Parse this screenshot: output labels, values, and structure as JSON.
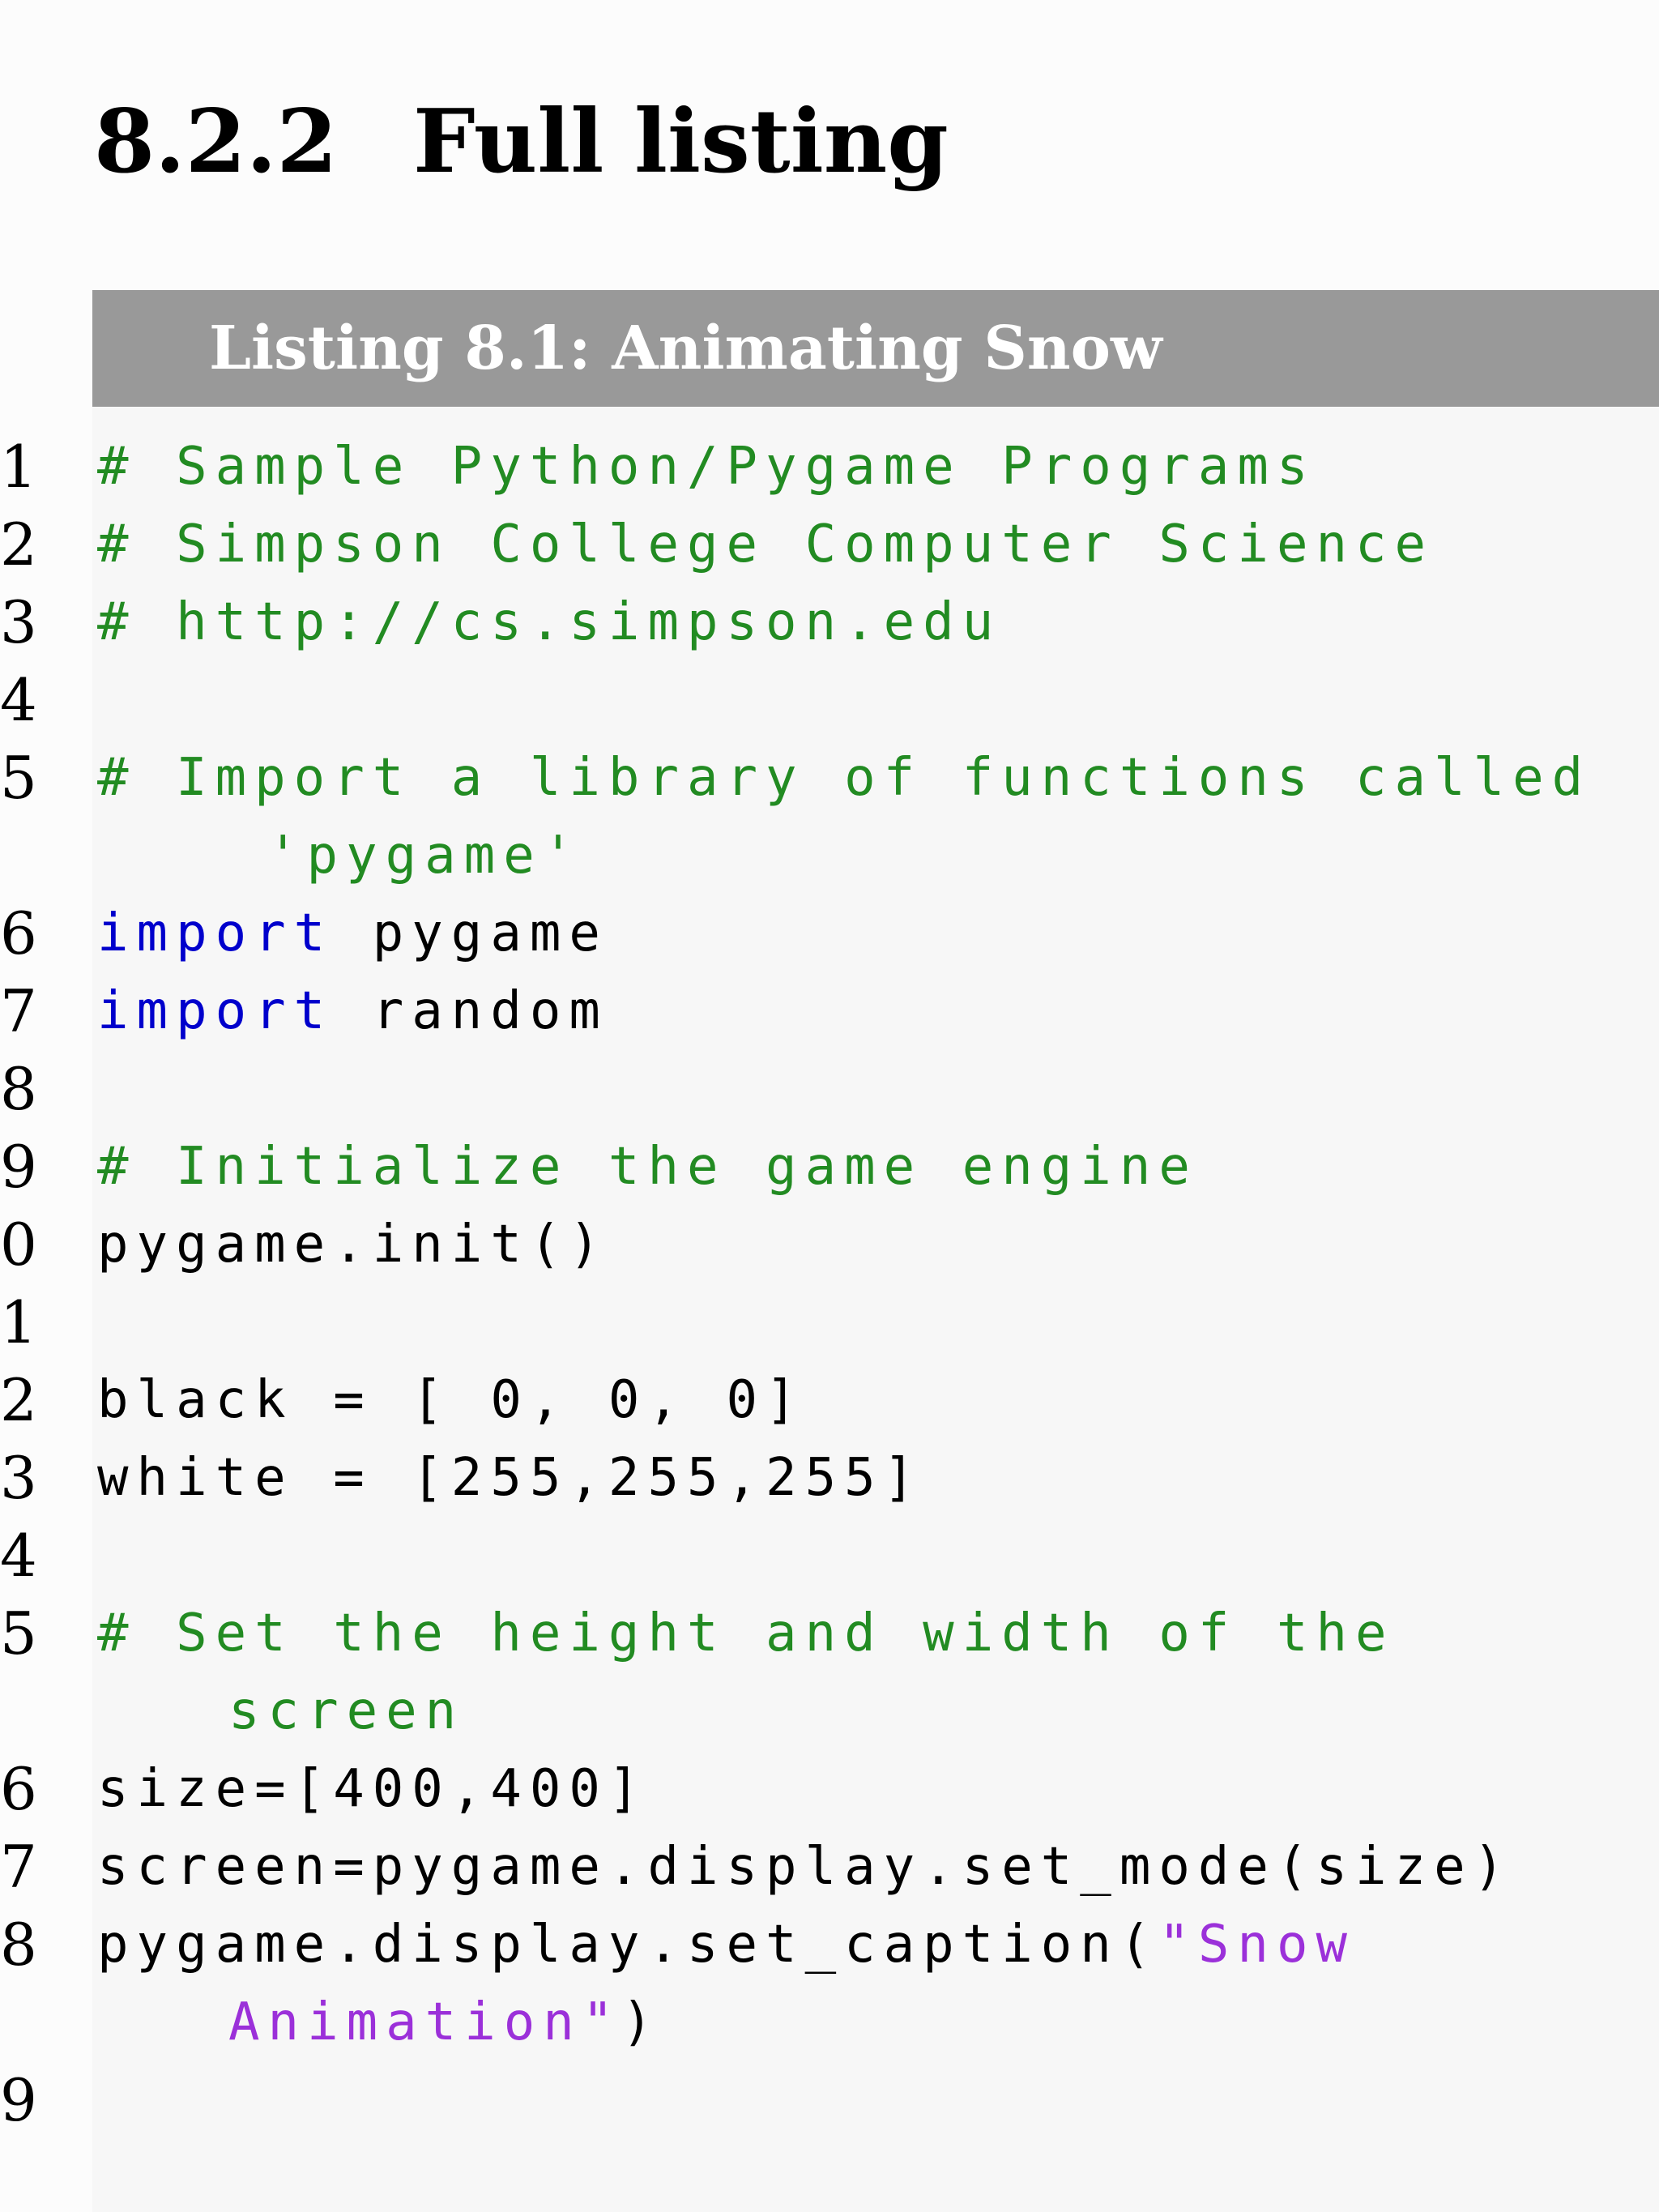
{
  "section": {
    "number": "8.2.2",
    "title": "Full listing"
  },
  "listing": {
    "caption": "Listing 8.1: Animating Snow",
    "line_numbers": [
      "1",
      "2",
      "3",
      "4",
      "5",
      "6",
      "7",
      "8",
      "9",
      "0",
      "1",
      "2",
      "3",
      "4",
      "5",
      "6",
      "7",
      "8",
      "9"
    ],
    "code": {
      "l1": "# Sample Python/Pygame Programs",
      "l2": "# Simpson College Computer Science",
      "l3": "# http://cs.simpson.edu",
      "l5a": "# Import a library of functions called",
      "l5b": "'pygame'",
      "l6_kw": "import",
      "l6_rest": " pygame",
      "l7_kw": "import",
      "l7_rest": " random",
      "l9": "# Initialize the game engine",
      "l10": "pygame.init()",
      "l12": "black = [ 0, 0, 0]",
      "l13": "white = [255,255,255]",
      "l15a": "# Set the height and width of the",
      "l15b": "screen",
      "l16": "size=[400,400]",
      "l17": "screen=pygame.display.set_mode(size)",
      "l18a_plain": "pygame.display.set_caption(",
      "l18a_str": "\"Snow",
      "l18b_str": "Animation\"",
      "l18b_plain": ")"
    }
  },
  "colors": {
    "comment": "#228b22",
    "keyword": "#0000cc",
    "string": "#9b30d9",
    "caption_bar": "#999999"
  }
}
